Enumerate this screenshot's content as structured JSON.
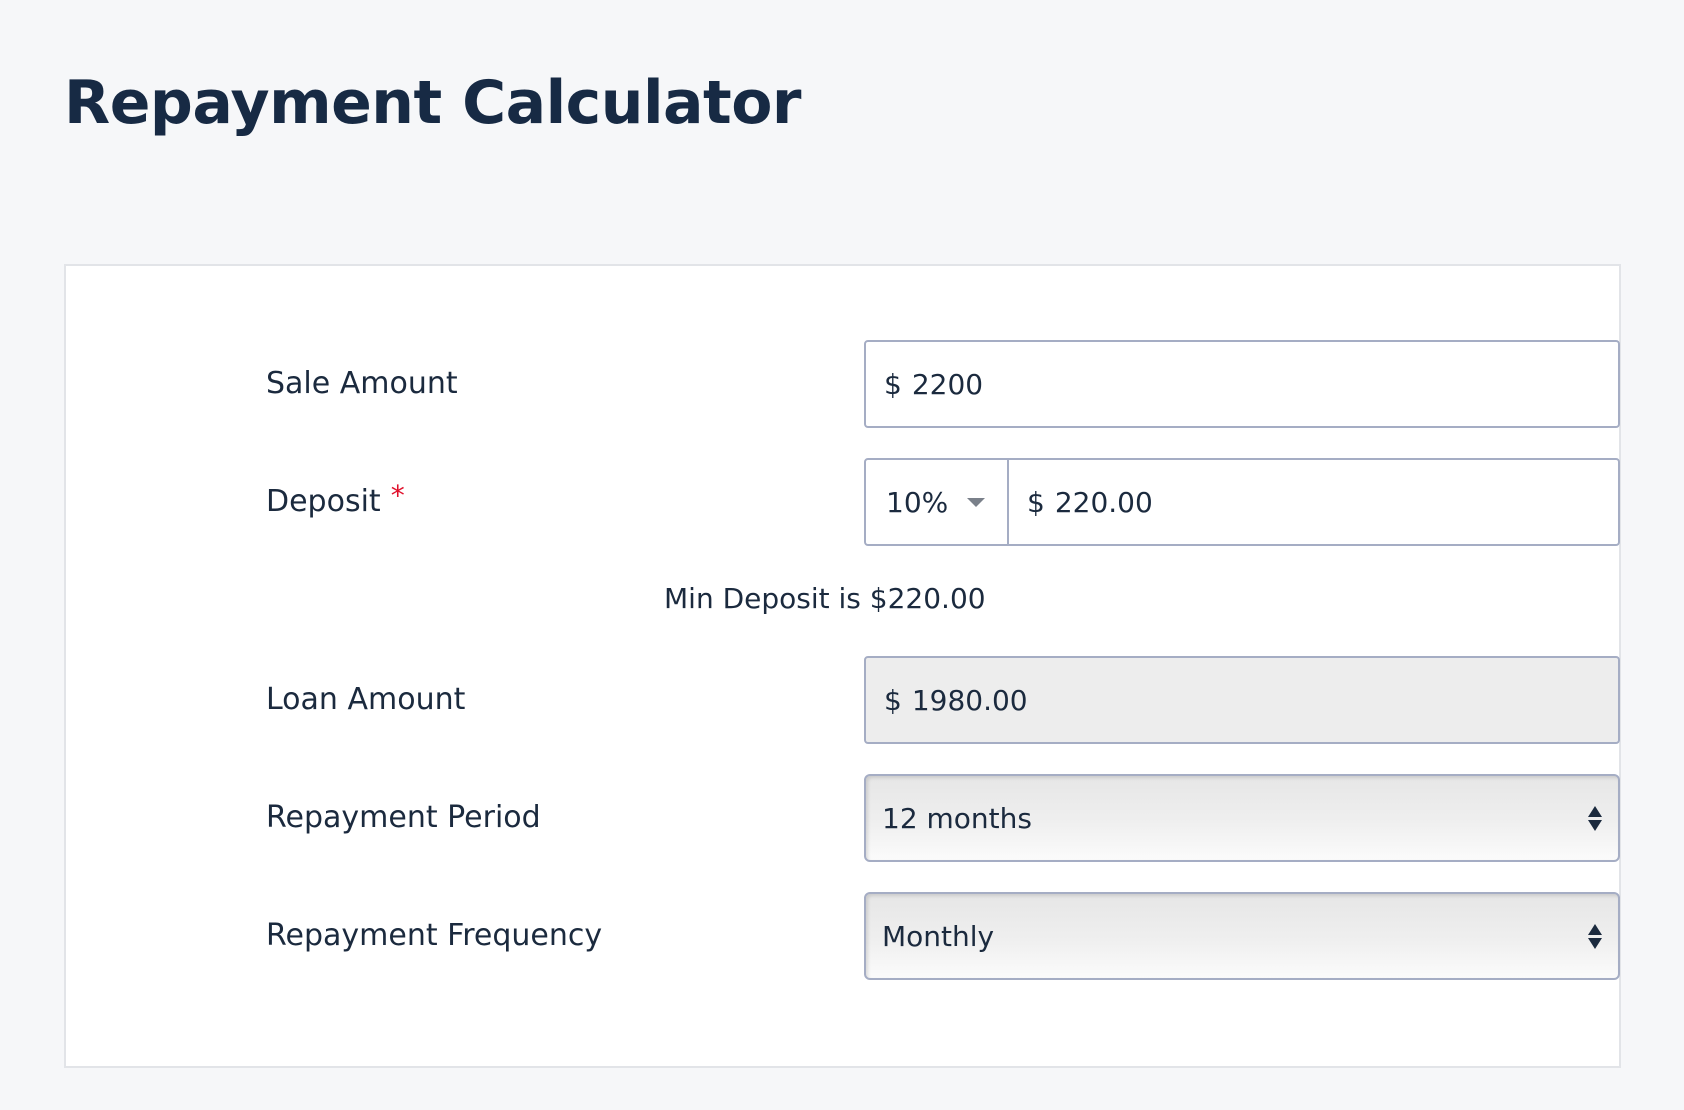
{
  "page": {
    "title": "Repayment Calculator"
  },
  "form": {
    "sale_amount": {
      "label": "Sale Amount",
      "currency": "$",
      "value": "2200"
    },
    "deposit": {
      "label": "Deposit",
      "required_mark": "*",
      "percent_selected": "10%",
      "currency": "$",
      "value": "220.00",
      "hint": "Min Deposit is $220.00"
    },
    "loan_amount": {
      "label": "Loan Amount",
      "currency": "$",
      "value": "1980.00"
    },
    "repayment_period": {
      "label": "Repayment Period",
      "selected": "12 months"
    },
    "repayment_frequency": {
      "label": "Repayment Frequency",
      "selected": "Monthly"
    }
  },
  "colors": {
    "background": "#f6f7f9",
    "card": "#ffffff",
    "text": "#1b2a3e",
    "border": "#a5adc4",
    "required": "#e0102b",
    "readonly_bg": "#ededed"
  },
  "icons": {
    "percent_dropdown": "caret-down-icon",
    "select_arrows": "updown-arrows-icon"
  }
}
